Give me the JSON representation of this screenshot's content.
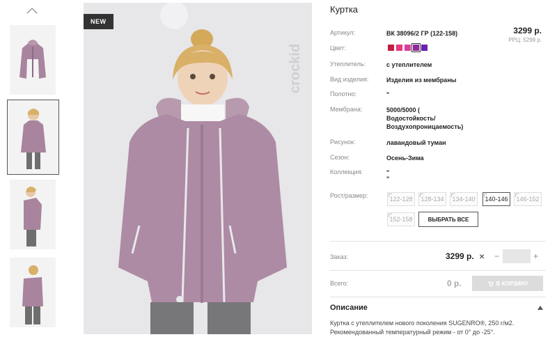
{
  "product": {
    "title": "Куртка",
    "badge": "NEW",
    "brand_logo_text": "crockid",
    "price": "3299 р.",
    "rrp": "РРЦ: 5299 р."
  },
  "specs": [
    {
      "label": "Артикул:",
      "value": "ВК 38096/2 ГР (122-158)"
    },
    {
      "label": "Цвет:",
      "value": ""
    },
    {
      "label": "Утеплитель:",
      "value": "с утеплителем"
    },
    {
      "label": "Вид изделия:",
      "value": "Изделия из мембраны"
    },
    {
      "label": "Полотно:",
      "value": "\""
    },
    {
      "label": "Мембрана:",
      "value_lines": [
        "5000/5000 (",
        "Водостойкость/",
        "Воздухопроницаемость)"
      ]
    },
    {
      "label": "Рисунок:",
      "value": "лавандовый туман"
    },
    {
      "label": "Сезон:",
      "value": "Осень-Зима"
    },
    {
      "label": "Коллекция:",
      "value_lines": [
        "\"",
        "\""
      ]
    }
  ],
  "colors": [
    "#c41f3e",
    "#e8397d",
    "#d8409c",
    "#8f2a9a",
    "#6a1fb0"
  ],
  "selected_color_index": 3,
  "size_label": "Рост/размер:",
  "sizes": [
    {
      "label": "122-128",
      "state": "disabled"
    },
    {
      "label": "128-134",
      "state": "disabled"
    },
    {
      "label": "134-140",
      "state": "disabled"
    },
    {
      "label": "140-146",
      "state": "active"
    },
    {
      "label": "146-152",
      "state": "disabled"
    },
    {
      "label": "152-158",
      "state": "disabled"
    }
  ],
  "select_all_label": "ВЫБРАТЬ ВСЕ",
  "order": {
    "label": "Заказ:",
    "price": "3299 р.",
    "times": "×",
    "minus": "−",
    "quantity": "",
    "plus": "+"
  },
  "total": {
    "label": "Всего:",
    "value": "0 р.",
    "cart_label": "В КОРЗИНУ"
  },
  "description": {
    "heading": "Описание",
    "text_lines": [
      "Куртка с утеплителем нового поколения SUGENRO®, 250 г/м2.",
      "Рекомендованный температурный режим - от 0° до -25°."
    ]
  },
  "accent": "#d6336c"
}
